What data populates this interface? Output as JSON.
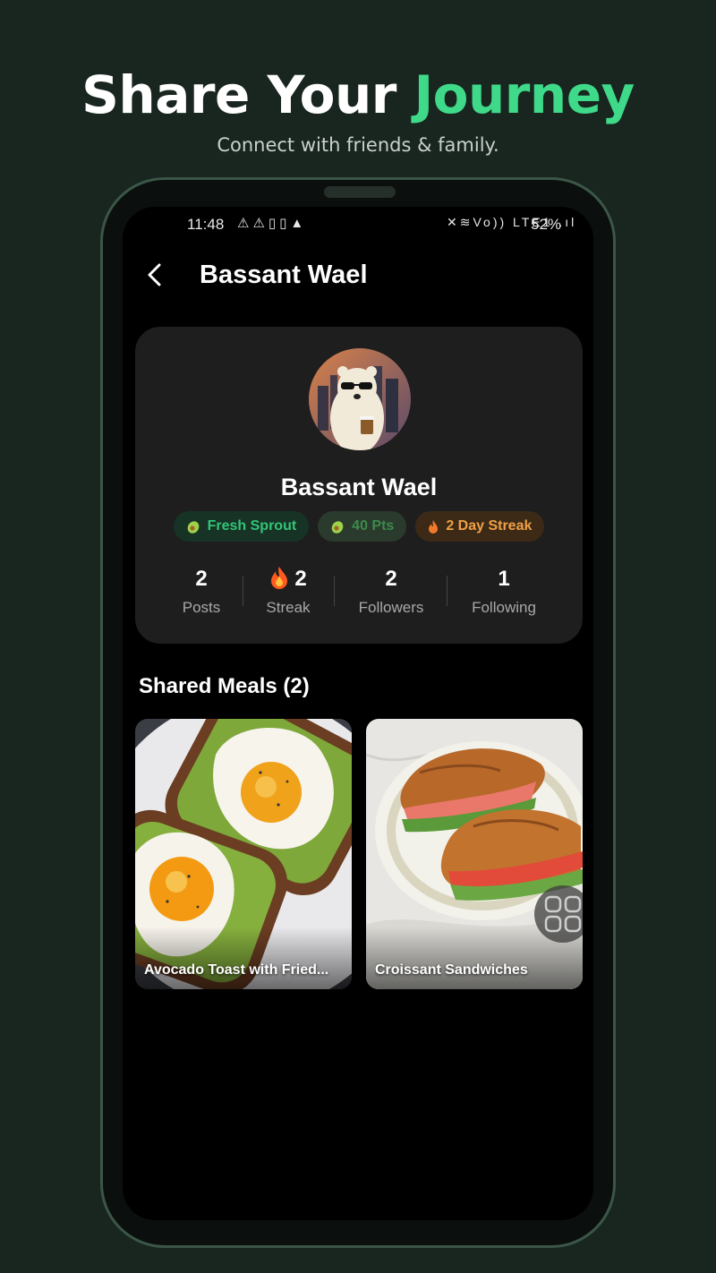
{
  "promo": {
    "headline_prefix": "Share Your ",
    "headline_accent": "Journey",
    "subline": "Connect with friends & family."
  },
  "status_bar": {
    "time": "11:48",
    "left_icons": "⚠⚠▯▯▲",
    "right_icons": "✕≋Vo)) LTE1 .ıl",
    "battery": "52%"
  },
  "app_bar": {
    "title": "Bassant Wael"
  },
  "profile": {
    "name": "Bassant Wael",
    "badges": [
      {
        "icon": "avocado-icon",
        "label": "Fresh Sprout"
      },
      {
        "icon": "avocado-icon",
        "label": "40 Pts"
      },
      {
        "icon": "fire-icon",
        "label": "2 Day Streak"
      }
    ],
    "stats": [
      {
        "value": "2",
        "label": "Posts"
      },
      {
        "value": "2",
        "label": "Streak",
        "icon": "fire-icon"
      },
      {
        "value": "2",
        "label": "Followers"
      },
      {
        "value": "1",
        "label": "Following"
      }
    ]
  },
  "shared_meals": {
    "title": "Shared Meals (2)",
    "items": [
      {
        "caption": "Avocado Toast with Fried Eggs",
        "caption_display": "Avocado Toast with Fried..."
      },
      {
        "caption": "Croissant Sandwiches",
        "caption_display": "Croissant Sandwiches"
      }
    ]
  },
  "colors": {
    "background": "#18261f",
    "accent": "#3fd98a",
    "card": "#1e1e1e"
  }
}
